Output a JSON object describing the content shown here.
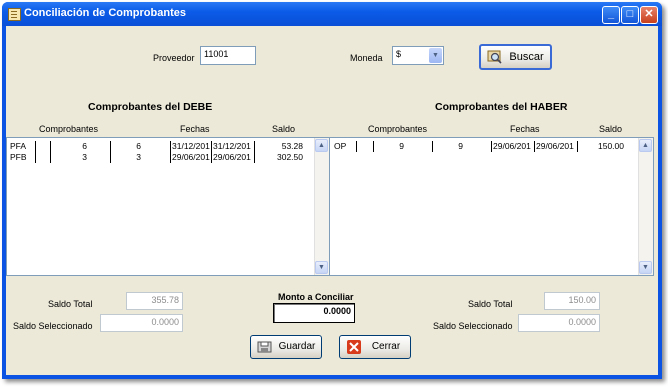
{
  "window": {
    "title": "Conciliación de Comprobantes",
    "minimize": "_",
    "maximize": "□",
    "close": "✕"
  },
  "header": {
    "proveedor_label": "Proveedor",
    "proveedor_value": "11001",
    "moneda_label": "Moneda",
    "moneda_value": "$",
    "buscar_label": "Buscar"
  },
  "debe": {
    "title": "Comprobantes del DEBE",
    "col_comprobantes": "Comprobantes",
    "col_fechas": "Fechas",
    "col_saldo": "Saldo",
    "rows": [
      {
        "tipo": "PFA",
        "n1": "6",
        "n2": "6",
        "f1": "31/12/201",
        "f2": "31/12/201",
        "saldo": "53.28"
      },
      {
        "tipo": "PFB",
        "n1": "3",
        "n2": "3",
        "f1": "29/06/201",
        "f2": "29/06/201",
        "saldo": "302.50"
      }
    ]
  },
  "haber": {
    "title": "Comprobantes del HABER",
    "col_comprobantes": "Comprobantes",
    "col_fechas": "Fechas",
    "col_saldo": "Saldo",
    "rows": [
      {
        "tipo": "OP",
        "n1": "9",
        "n2": "9",
        "f1": "29/06/201",
        "f2": "29/06/201",
        "saldo": "150.00"
      }
    ]
  },
  "footer": {
    "saldo_total_label": "Saldo Total",
    "saldo_sel_label": "Saldo Seleccionado",
    "debe_total": "355.78",
    "debe_sel": "0.0000",
    "monto_label": "Monto a Conciliar",
    "monto_value": "0.0000",
    "haber_total": "150.00",
    "haber_sel": "0.0000",
    "guardar_label": "Guardar",
    "cerrar_label": "Cerrar"
  }
}
